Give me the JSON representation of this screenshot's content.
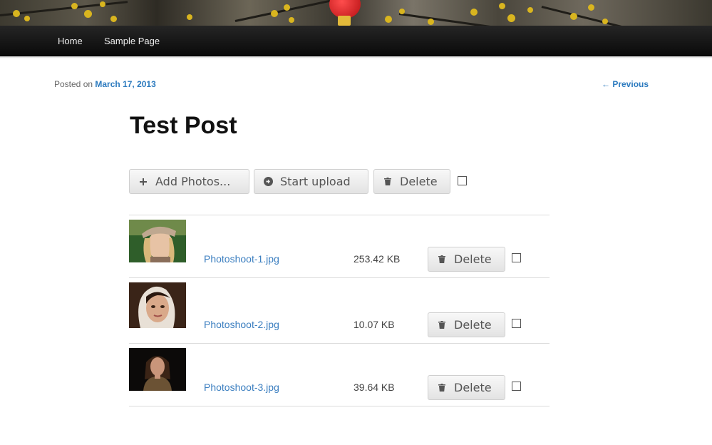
{
  "nav": {
    "items": [
      {
        "label": "Home"
      },
      {
        "label": "Sample Page"
      }
    ]
  },
  "post": {
    "posted_on_label": "Posted on",
    "date": "March 17, 2013",
    "previous_label": "← Previous",
    "title": "Test Post"
  },
  "toolbar": {
    "add_label": "Add Photos...",
    "start_label": "Start upload",
    "delete_label": "Delete"
  },
  "files": [
    {
      "name": "Photoshoot-1.jpg",
      "size": "253.42 KB",
      "delete_label": "Delete"
    },
    {
      "name": "Photoshoot-2.jpg",
      "size": "10.07 KB",
      "delete_label": "Delete"
    },
    {
      "name": "Photoshoot-3.jpg",
      "size": "39.64 KB",
      "delete_label": "Delete"
    }
  ],
  "colors": {
    "link": "#3c7fc0",
    "navbar": "#141414",
    "lantern": "#d4141a",
    "blossom": "#d9b51f"
  },
  "icons": {
    "add": "plus-icon",
    "start": "arrow-circle-icon",
    "delete": "trash-icon"
  }
}
